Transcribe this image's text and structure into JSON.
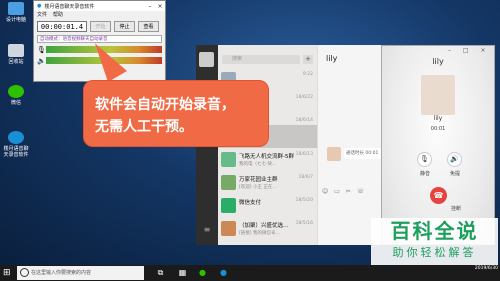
{
  "desktop": {
    "icons": [
      {
        "label": "设计电脑"
      },
      {
        "label": "回收站"
      },
      {
        "label": "微信"
      },
      {
        "label": "楼月语音聊天录音软件"
      }
    ]
  },
  "recorder": {
    "title": "楼月语音聊天录音软件",
    "menu": [
      "文件",
      "帮助"
    ],
    "time": "00:00:01.4",
    "btn_start": "开始",
    "btn_stop": "停止",
    "btn_view": "查看",
    "mode_text": "自动模式：语音视频聊天自动录音",
    "mic_icon": "🎙",
    "speaker_icon": "🔈"
  },
  "wechat": {
    "search_placeholder": "搜索",
    "plus": "+",
    "chats": [
      {
        "name": "",
        "snippet": "",
        "time": "9:22"
      },
      {
        "name": "",
        "snippet": "",
        "time": "18/6/22"
      },
      {
        "name": "",
        "snippet": "",
        "time": "18/6/14"
      },
      {
        "name": "lily",
        "snippet": "",
        "time": ""
      },
      {
        "name": "飞路无人机交流群-5群",
        "snippet": "我的电（七七·快…",
        "time": "18/6/13"
      },
      {
        "name": "万家花园业主群",
        "snippet": "[欢迎] 小王 正在…",
        "time": "18/6/7"
      },
      {
        "name": "微信支付",
        "snippet": "",
        "time": "18/5/20"
      },
      {
        "name": "（加聚）兴盛优选…",
        "snippet": "[链接] 我的微信号…",
        "time": "18/5/16"
      }
    ],
    "chat_name": "lily",
    "chat_message": "通话时长 00:01",
    "tools": "☺ ▭ ✂ ☏"
  },
  "call": {
    "title": "lily",
    "name": "lily",
    "duration": "00:01",
    "mute_label": "静音",
    "speaker_label": "免提",
    "hangup_label": "挂断",
    "window_controls": "– □ ×"
  },
  "callout": {
    "line1": "软件会自动开始录音，",
    "line2": "无需人工干预。"
  },
  "watermark": {
    "line1": "百科全说",
    "line2": "助你轻松解答"
  },
  "taskbar": {
    "search_text": "在这里输入你要搜索的内容",
    "clock_time": "2019/6/30"
  }
}
